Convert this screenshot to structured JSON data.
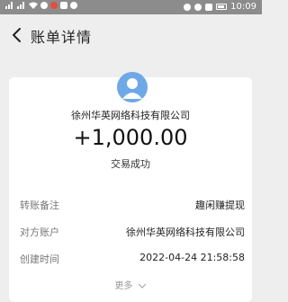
{
  "status_bar": {
    "time": "10:09"
  },
  "header": {
    "title": "账单详情"
  },
  "bill": {
    "counterparty_name": "徐州华英网络科技有限公司",
    "amount": "+1,000.00",
    "status": "交易成功"
  },
  "details": [
    {
      "label": "转账备注",
      "value": "趣闲赚提现"
    },
    {
      "label": "对方账户",
      "value": "徐州华英网络科技有限公司"
    },
    {
      "label": "创建时间",
      "value": "2022-04-24 21:58:58"
    }
  ],
  "more_label": "更多",
  "icons": {
    "back": "chevron-left-icon",
    "avatar": "user-icon",
    "more": "chevron-down-icon"
  },
  "colors": {
    "avatar": "#6fa8e6",
    "status_bar": "#8c8c8c"
  }
}
